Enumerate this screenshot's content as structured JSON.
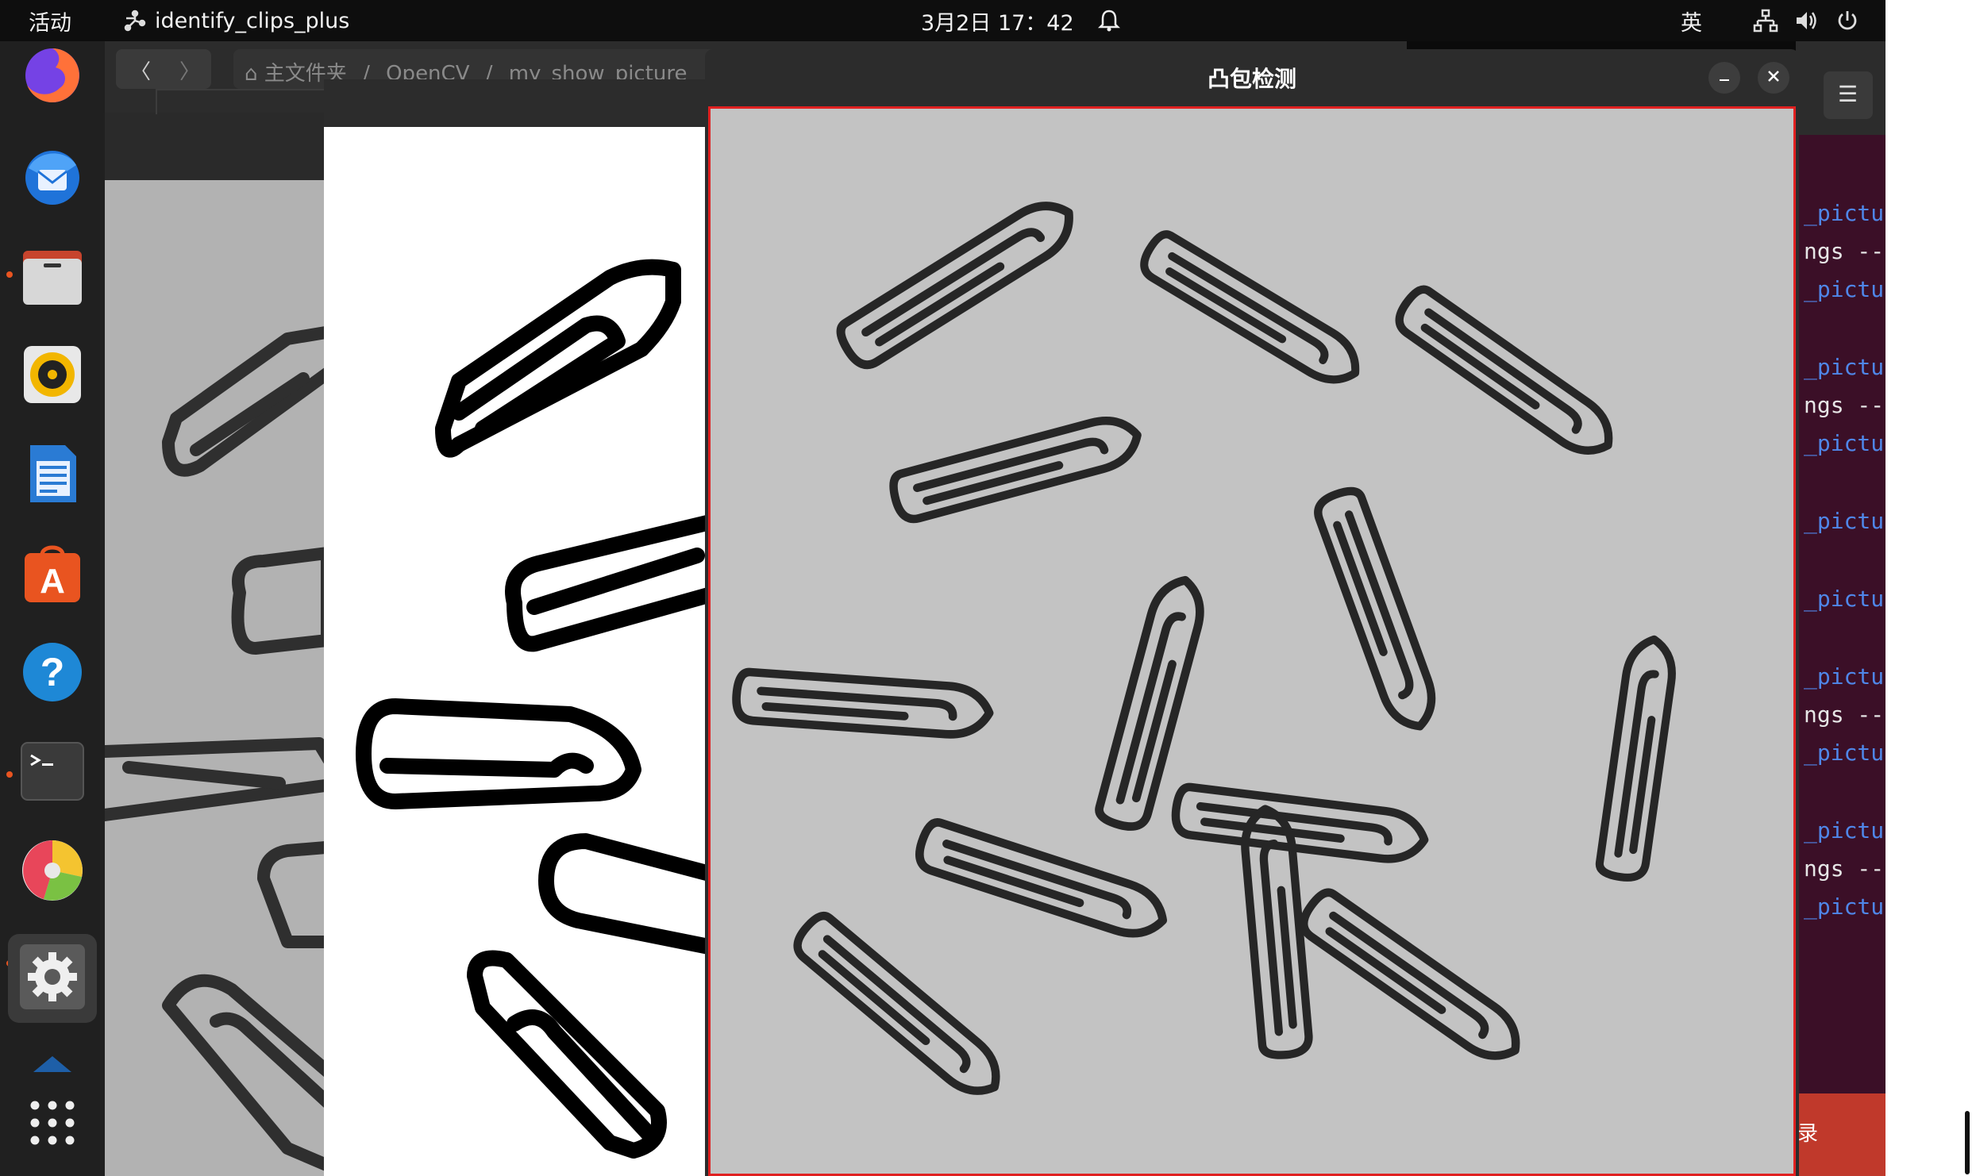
{
  "topbar": {
    "activities_label": "活动",
    "app_name": "identify_clips_plus",
    "clock": "3月2日  17：42",
    "input_method": "英"
  },
  "dock": {
    "items": [
      {
        "name": "firefox",
        "icon": "firefox-icon"
      },
      {
        "name": "thunderbird",
        "icon": "thunderbird-icon"
      },
      {
        "name": "files",
        "icon": "files-icon",
        "running": true
      },
      {
        "name": "rhythmbox",
        "icon": "rhythmbox-icon"
      },
      {
        "name": "writer",
        "icon": "writer-icon"
      },
      {
        "name": "software",
        "icon": "software-center-icon"
      },
      {
        "name": "help",
        "icon": "help-icon"
      },
      {
        "name": "terminal",
        "icon": "terminal-icon",
        "running": true
      },
      {
        "name": "disk-usage",
        "icon": "pie-chart-icon"
      },
      {
        "name": "settings",
        "icon": "settings-gear-icon",
        "running": true
      },
      {
        "name": "show-apps",
        "icon": "app-grid-icon"
      }
    ]
  },
  "file_window": {
    "breadcrumb": [
      "主文件夹",
      "OpenCV",
      "my_show_picture"
    ]
  },
  "main_window": {
    "title": "凸包检测"
  },
  "terminal": {
    "lines": [
      {
        "text": "_pictur",
        "kind": "pic"
      },
      {
        "text": "ngs --l",
        "kind": "arg"
      },
      {
        "text": "_pictur",
        "kind": "pic"
      },
      {
        "text": "_pictur",
        "kind": "pic"
      },
      {
        "text": "ngs --l",
        "kind": "arg"
      },
      {
        "text": "_pictur",
        "kind": "pic"
      },
      {
        "text": "_pictur",
        "kind": "pic"
      },
      {
        "text": "_pictur",
        "kind": "pic"
      },
      {
        "text": "_pictur",
        "kind": "pic"
      },
      {
        "text": "ngs --l",
        "kind": "arg"
      },
      {
        "text": "_pictur",
        "kind": "pic"
      },
      {
        "text": "_pictur",
        "kind": "pic"
      },
      {
        "text": "ngs --l",
        "kind": "arg"
      },
      {
        "text": "_pictur",
        "kind": "pic"
      }
    ],
    "bottom_text": "录"
  },
  "colors": {
    "accent": "#e95420",
    "window_border": "#e02020",
    "terminal_bg": "#3b0f27",
    "terminal_path": "#4f86e8"
  }
}
